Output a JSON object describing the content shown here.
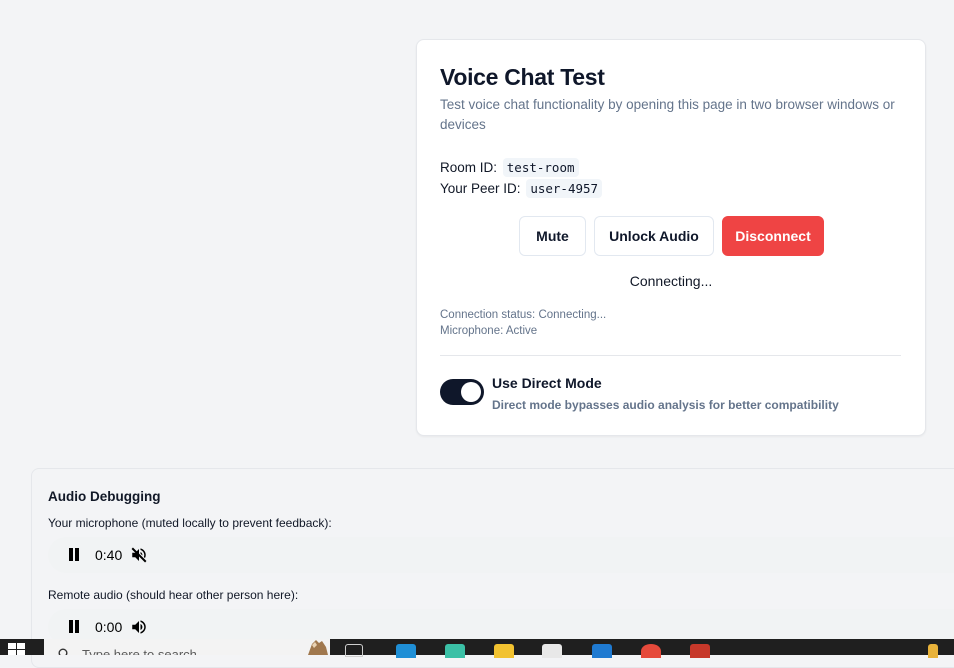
{
  "card": {
    "title": "Voice Chat Test",
    "description": "Test voice chat functionality by opening this page in two browser windows or devices",
    "room_label": "Room ID:",
    "room_value": "test-room",
    "peer_label": "Your Peer ID:",
    "peer_value": "user-4957",
    "buttons": {
      "mute": "Mute",
      "unlock_audio": "Unlock Audio",
      "disconnect": "Disconnect"
    },
    "connecting_text": "Connecting...",
    "connection_status": "Connection status: Connecting...",
    "microphone_status": "Microphone: Active",
    "toggle": {
      "label": "Use Direct Mode",
      "description": "Direct mode bypasses audio analysis for better compatibility",
      "checked": true
    }
  },
  "debug": {
    "title": "Audio Debugging",
    "mic_label": "Your microphone (muted locally to prevent feedback):",
    "mic_time": "0:40",
    "mic_icon": "volume-muted-icon",
    "remote_label": "Remote audio (should hear other person here):",
    "remote_time": "0:00",
    "remote_icon": "volume-icon"
  },
  "taskbar": {
    "search_placeholder": "Type here to search",
    "apps": [
      "task-view-icon",
      "edge-icon",
      "browser-icon",
      "file-explorer-icon",
      "store-icon",
      "vscode-icon",
      "chrome-icon",
      "app-icon"
    ]
  },
  "colors": {
    "accent_danger": "#ef4444",
    "toggle_on": "#0f172a",
    "page_bg": "#f3f4f6",
    "muted_text": "#64748b"
  }
}
